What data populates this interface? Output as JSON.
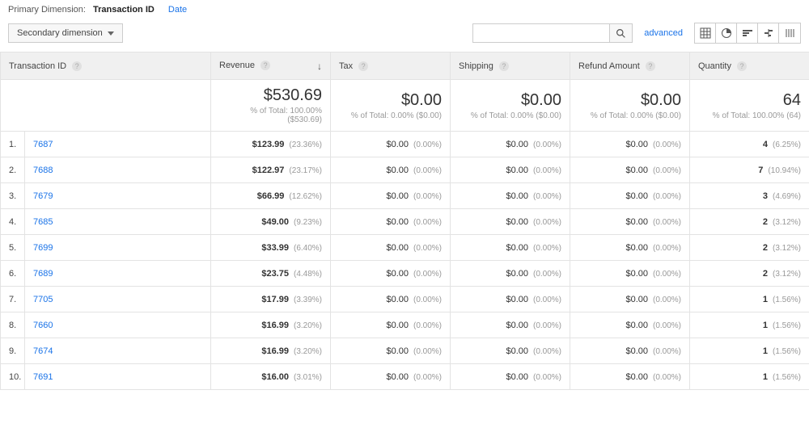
{
  "primary_dimension": {
    "label": "Primary Dimension:",
    "active": "Transaction ID",
    "other": "Date"
  },
  "controls": {
    "secondary_dimension": "Secondary dimension",
    "advanced": "advanced"
  },
  "columns": {
    "transaction_id": "Transaction ID",
    "revenue": "Revenue",
    "tax": "Tax",
    "shipping": "Shipping",
    "refund": "Refund Amount",
    "quantity": "Quantity"
  },
  "summary": {
    "revenue": {
      "value": "$530.69",
      "sub": "% of Total: 100.00% ($530.69)"
    },
    "tax": {
      "value": "$0.00",
      "sub": "% of Total: 0.00% ($0.00)"
    },
    "shipping": {
      "value": "$0.00",
      "sub": "% of Total: 0.00% ($0.00)"
    },
    "refund": {
      "value": "$0.00",
      "sub": "% of Total: 0.00% ($0.00)"
    },
    "quantity": {
      "value": "64",
      "sub": "% of Total: 100.00% (64)"
    }
  },
  "rows": [
    {
      "idx": "1.",
      "tx": "7687",
      "rev_v": "$123.99",
      "rev_p": "(23.36%)",
      "tax_v": "$0.00",
      "tax_p": "(0.00%)",
      "ship_v": "$0.00",
      "ship_p": "(0.00%)",
      "ref_v": "$0.00",
      "ref_p": "(0.00%)",
      "qty_v": "4",
      "qty_p": "(6.25%)"
    },
    {
      "idx": "2.",
      "tx": "7688",
      "rev_v": "$122.97",
      "rev_p": "(23.17%)",
      "tax_v": "$0.00",
      "tax_p": "(0.00%)",
      "ship_v": "$0.00",
      "ship_p": "(0.00%)",
      "ref_v": "$0.00",
      "ref_p": "(0.00%)",
      "qty_v": "7",
      "qty_p": "(10.94%)"
    },
    {
      "idx": "3.",
      "tx": "7679",
      "rev_v": "$66.99",
      "rev_p": "(12.62%)",
      "tax_v": "$0.00",
      "tax_p": "(0.00%)",
      "ship_v": "$0.00",
      "ship_p": "(0.00%)",
      "ref_v": "$0.00",
      "ref_p": "(0.00%)",
      "qty_v": "3",
      "qty_p": "(4.69%)"
    },
    {
      "idx": "4.",
      "tx": "7685",
      "rev_v": "$49.00",
      "rev_p": "(9.23%)",
      "tax_v": "$0.00",
      "tax_p": "(0.00%)",
      "ship_v": "$0.00",
      "ship_p": "(0.00%)",
      "ref_v": "$0.00",
      "ref_p": "(0.00%)",
      "qty_v": "2",
      "qty_p": "(3.12%)"
    },
    {
      "idx": "5.",
      "tx": "7699",
      "rev_v": "$33.99",
      "rev_p": "(6.40%)",
      "tax_v": "$0.00",
      "tax_p": "(0.00%)",
      "ship_v": "$0.00",
      "ship_p": "(0.00%)",
      "ref_v": "$0.00",
      "ref_p": "(0.00%)",
      "qty_v": "2",
      "qty_p": "(3.12%)"
    },
    {
      "idx": "6.",
      "tx": "7689",
      "rev_v": "$23.75",
      "rev_p": "(4.48%)",
      "tax_v": "$0.00",
      "tax_p": "(0.00%)",
      "ship_v": "$0.00",
      "ship_p": "(0.00%)",
      "ref_v": "$0.00",
      "ref_p": "(0.00%)",
      "qty_v": "2",
      "qty_p": "(3.12%)"
    },
    {
      "idx": "7.",
      "tx": "7705",
      "rev_v": "$17.99",
      "rev_p": "(3.39%)",
      "tax_v": "$0.00",
      "tax_p": "(0.00%)",
      "ship_v": "$0.00",
      "ship_p": "(0.00%)",
      "ref_v": "$0.00",
      "ref_p": "(0.00%)",
      "qty_v": "1",
      "qty_p": "(1.56%)"
    },
    {
      "idx": "8.",
      "tx": "7660",
      "rev_v": "$16.99",
      "rev_p": "(3.20%)",
      "tax_v": "$0.00",
      "tax_p": "(0.00%)",
      "ship_v": "$0.00",
      "ship_p": "(0.00%)",
      "ref_v": "$0.00",
      "ref_p": "(0.00%)",
      "qty_v": "1",
      "qty_p": "(1.56%)"
    },
    {
      "idx": "9.",
      "tx": "7674",
      "rev_v": "$16.99",
      "rev_p": "(3.20%)",
      "tax_v": "$0.00",
      "tax_p": "(0.00%)",
      "ship_v": "$0.00",
      "ship_p": "(0.00%)",
      "ref_v": "$0.00",
      "ref_p": "(0.00%)",
      "qty_v": "1",
      "qty_p": "(1.56%)"
    },
    {
      "idx": "10.",
      "tx": "7691",
      "rev_v": "$16.00",
      "rev_p": "(3.01%)",
      "tax_v": "$0.00",
      "tax_p": "(0.00%)",
      "ship_v": "$0.00",
      "ship_p": "(0.00%)",
      "ref_v": "$0.00",
      "ref_p": "(0.00%)",
      "qty_v": "1",
      "qty_p": "(1.56%)"
    }
  ]
}
